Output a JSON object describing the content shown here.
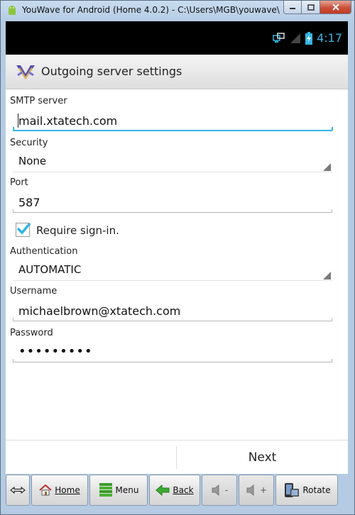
{
  "window": {
    "title": "YouWave for Android (Home 4.0.2) - C:\\Users\\MGB\\youwave\\",
    "controls": [
      "minimize",
      "maximize",
      "close"
    ]
  },
  "statusbar": {
    "time": "4:17",
    "time_color": "#33b5e5",
    "icons": [
      "network-sync-icon",
      "signal-icon",
      "battery-charging-icon"
    ]
  },
  "actionbar": {
    "title": "Outgoing server settings",
    "logo_icon": "app-logo-icon"
  },
  "form": {
    "smtp_server": {
      "label": "SMTP server",
      "value": "mail.xtatech.com",
      "focused": true
    },
    "security": {
      "label": "Security",
      "value": "None"
    },
    "port": {
      "label": "Port",
      "value": "587"
    },
    "require_signin": {
      "label": "Require sign-in.",
      "checked": true
    },
    "authentication": {
      "label": "Authentication",
      "value": "AUTOMATIC"
    },
    "username": {
      "label": "Username",
      "value": "michaelbrown@xtatech.com"
    },
    "password": {
      "label": "Password",
      "value": "•••••••••"
    }
  },
  "bottom": {
    "next_label": "Next"
  },
  "toolbar": {
    "home_label": "Home",
    "menu_label": "Menu",
    "back_label": "Back",
    "vol_down_label": "-",
    "vol_up_label": "+",
    "rotate_label": "Rotate"
  },
  "colors": {
    "accent": "#33b5e5",
    "checkbox": "#33b5e5"
  }
}
